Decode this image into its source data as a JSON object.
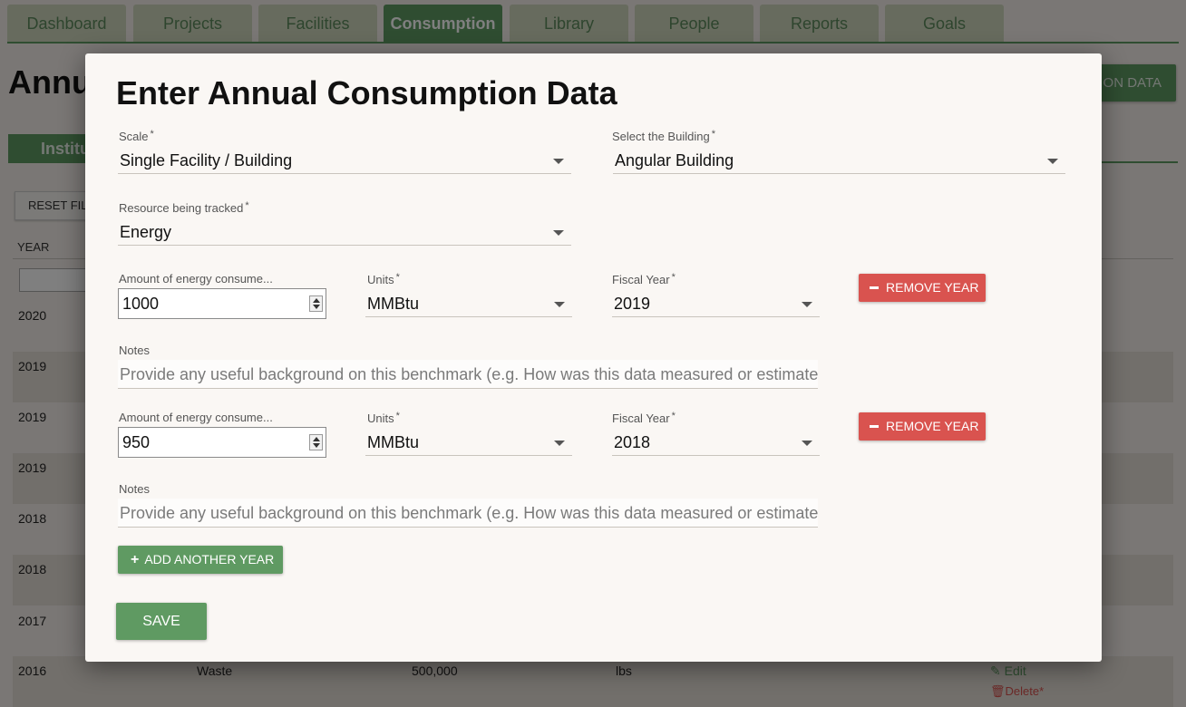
{
  "nav": {
    "tabs": [
      {
        "label": "Dashboard",
        "active": false
      },
      {
        "label": "Projects",
        "active": false
      },
      {
        "label": "Facilities",
        "active": false
      },
      {
        "label": "Consumption",
        "active": true
      },
      {
        "label": "Library",
        "active": false
      },
      {
        "label": "People",
        "active": false
      },
      {
        "label": "Reports",
        "active": false
      },
      {
        "label": "Goals",
        "active": false
      }
    ]
  },
  "background": {
    "page_title": "Annu",
    "add_button_label": "ON DATA",
    "subtab_label": "Institu",
    "reset_filters_label": "RESET FILT",
    "year_col_header": "YEAR",
    "rows": [
      {
        "year": "2020"
      },
      {
        "year": "2019"
      },
      {
        "year": "2019"
      },
      {
        "year": "2019"
      },
      {
        "year": "2018"
      },
      {
        "year": "2018"
      },
      {
        "year": "2017"
      },
      {
        "year": "2016",
        "resource": "Waste",
        "amount": "500,000",
        "units": "lbs",
        "edit": "Edit",
        "delete": "Delete*"
      }
    ]
  },
  "modal": {
    "title": "Enter Annual Consumption Data",
    "scale": {
      "label": "Scale",
      "value": "Single Facility / Building"
    },
    "building": {
      "label": "Select the Building",
      "value": "Angular Building"
    },
    "resource": {
      "label": "Resource being tracked",
      "value": "Energy"
    },
    "entries": [
      {
        "amount_label": "Amount of energy consume...",
        "amount": "1000",
        "units_label": "Units",
        "units": "MMBtu",
        "year_label": "Fiscal Year",
        "year": "2019",
        "remove_label": "REMOVE YEAR",
        "notes_label": "Notes",
        "notes_placeholder": "Provide any useful background on this benchmark (e.g. How was this data measured or estimated?"
      },
      {
        "amount_label": "Amount of energy consume...",
        "amount": "950",
        "units_label": "Units",
        "units": "MMBtu",
        "year_label": "Fiscal Year",
        "year": "2018",
        "remove_label": "REMOVE YEAR",
        "notes_label": "Notes",
        "notes_placeholder": "Provide any useful background on this benchmark (e.g. How was this data measured or estimated?"
      }
    ],
    "add_year_label": "ADD ANOTHER YEAR",
    "save_label": "SAVE",
    "required_mark": "*"
  },
  "colors": {
    "primary_green": "#5f9a62",
    "danger_red": "#d9534f",
    "tab_inactive": "#cfd6bc"
  }
}
